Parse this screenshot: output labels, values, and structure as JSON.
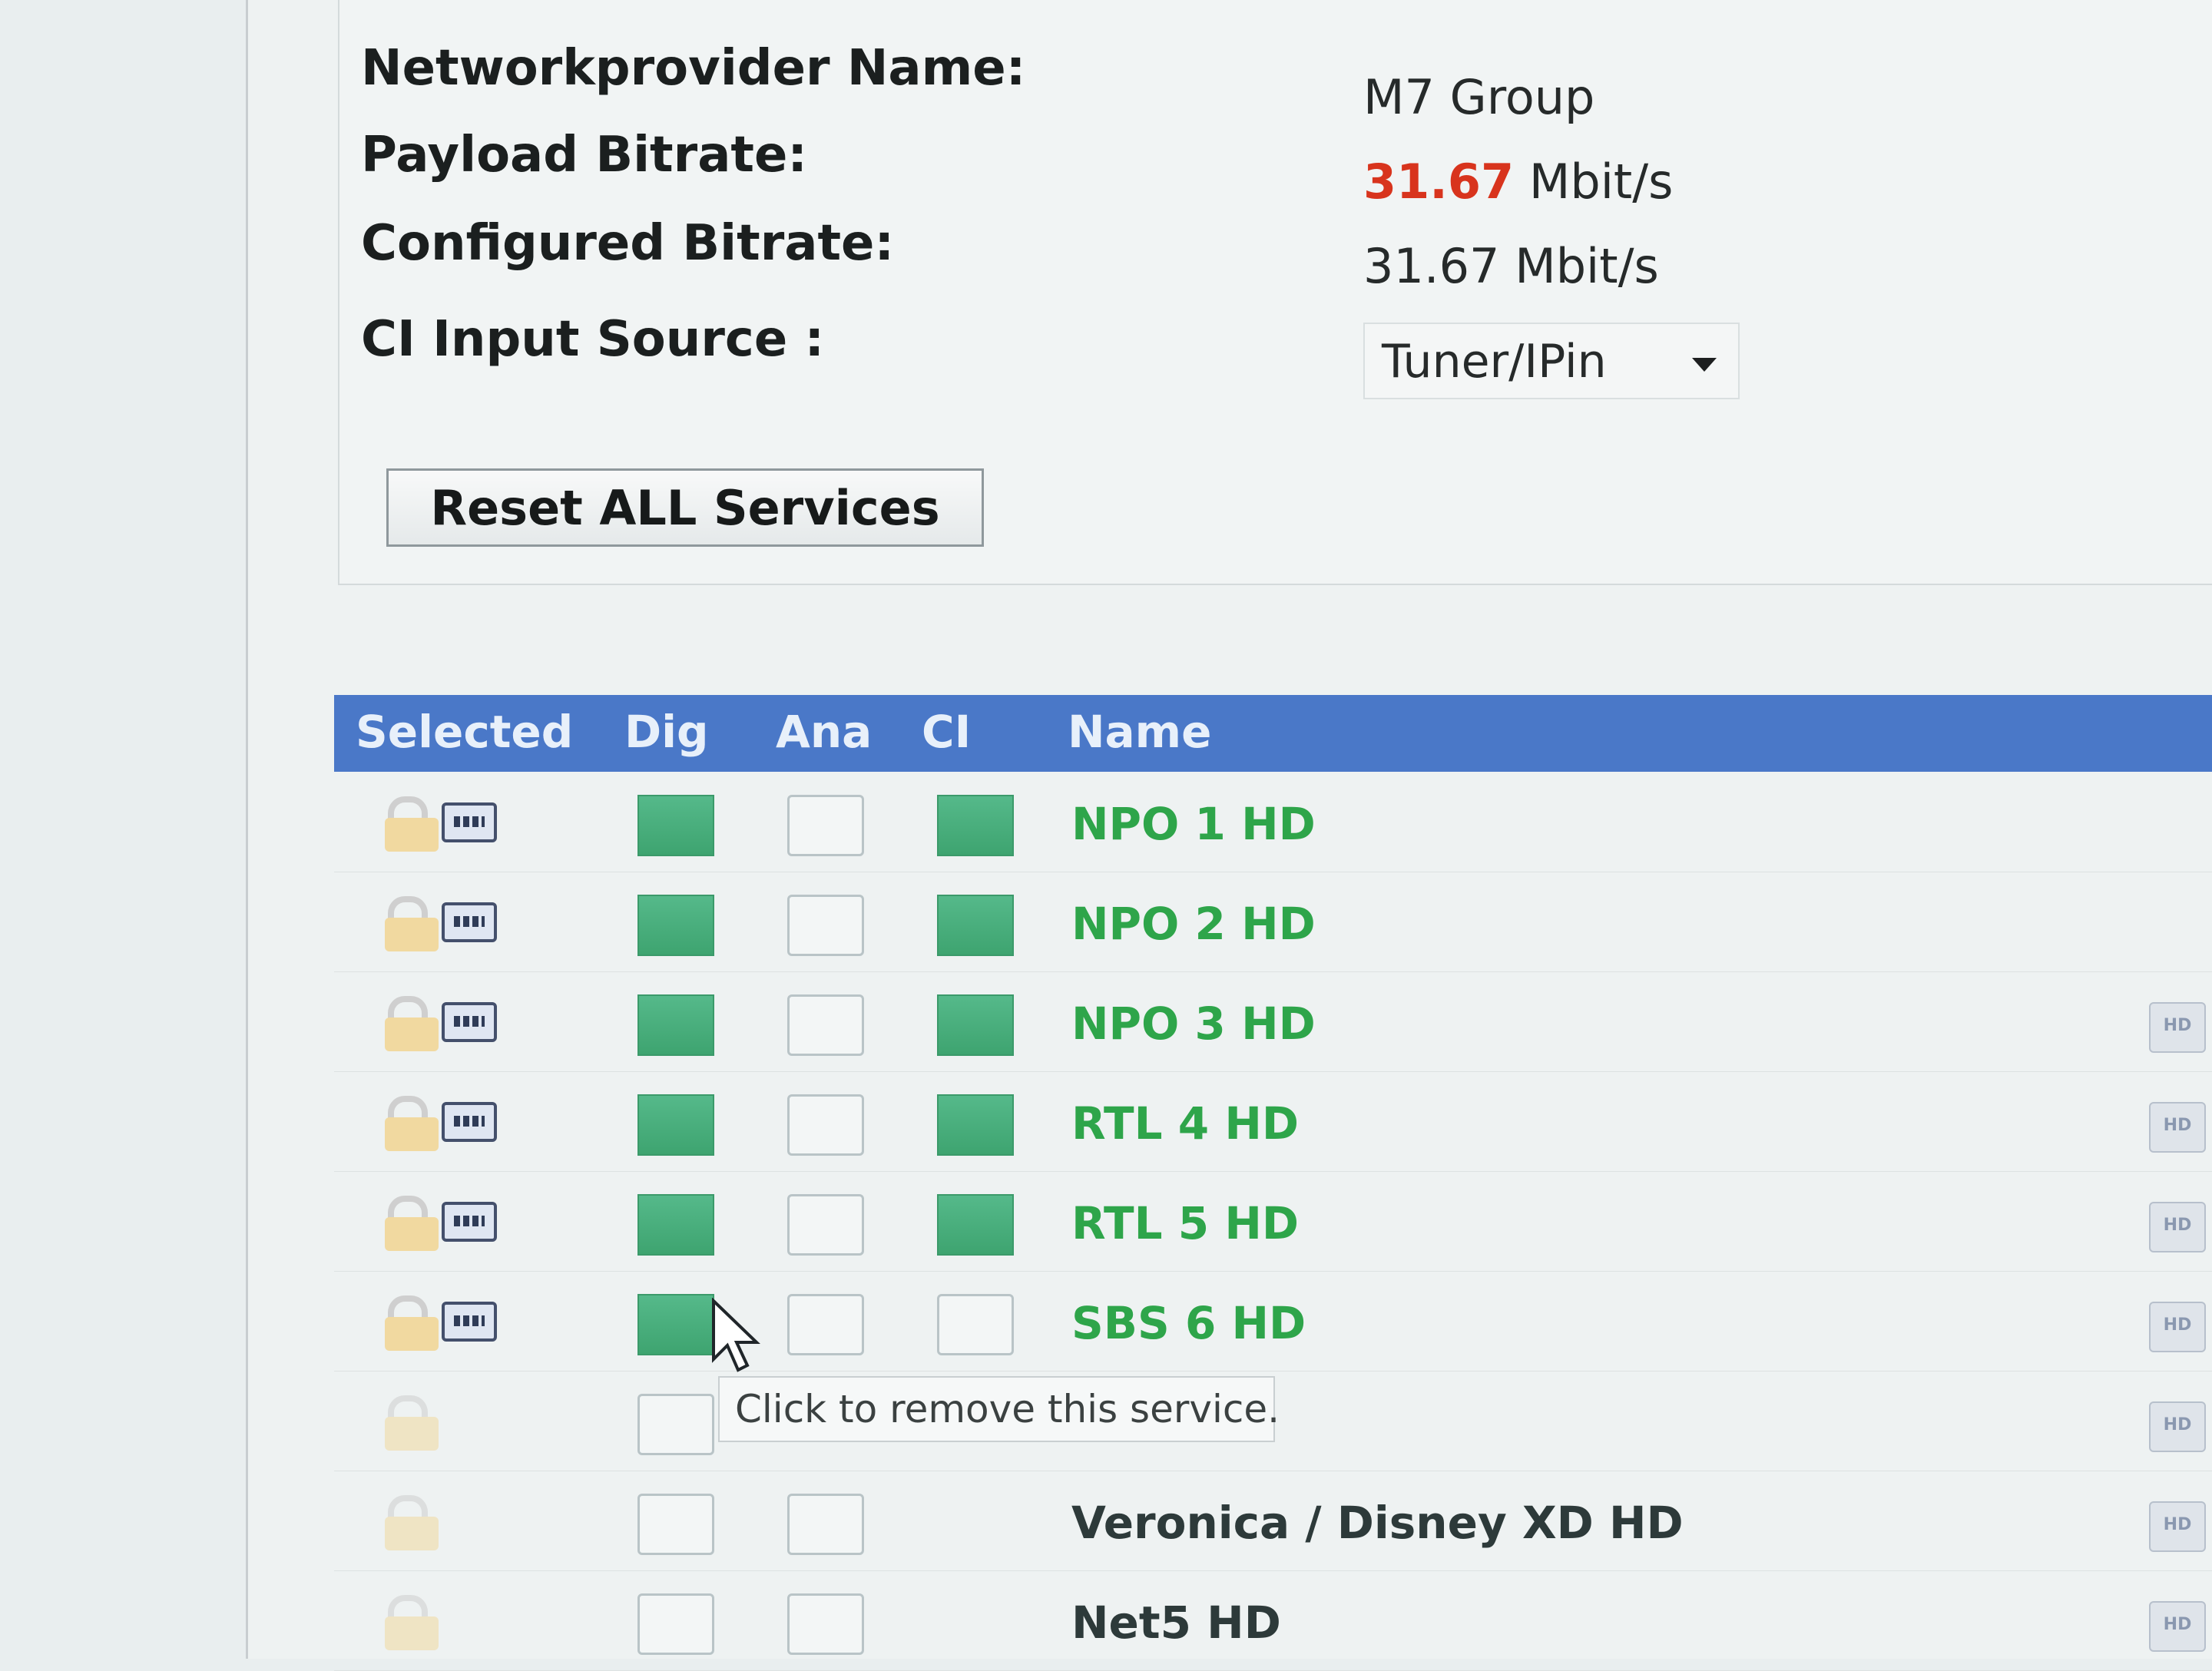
{
  "info": {
    "provider_label": "Networkprovider Name:",
    "provider_value": "M7 Group",
    "payload_label": "Payload Bitrate:",
    "payload_number": "31.67",
    "payload_unit": "Mbit/s",
    "configured_label": "Configured Bitrate:",
    "configured_value": "31.67 Mbit/s",
    "ci_label": "CI Input Source :",
    "ci_selected": "Tuner/IPin",
    "reset_label": "Reset ALL Services"
  },
  "table": {
    "headers": {
      "selected": "Selected",
      "dig": "Dig",
      "ana": "Ana",
      "ci": "CI",
      "name": "Name"
    },
    "rows": [
      {
        "name": "NPO 1 HD",
        "selected": true,
        "dig": true,
        "ana": false,
        "ci": true
      },
      {
        "name": "NPO 2 HD",
        "selected": true,
        "dig": true,
        "ana": false,
        "ci": true
      },
      {
        "name": "NPO 3 HD",
        "selected": true,
        "dig": true,
        "ana": false,
        "ci": true
      },
      {
        "name": "RTL 4 HD",
        "selected": true,
        "dig": true,
        "ana": false,
        "ci": true
      },
      {
        "name": "RTL 5 HD",
        "selected": true,
        "dig": true,
        "ana": false,
        "ci": true
      },
      {
        "name": "SBS 6 HD",
        "selected": true,
        "dig": true,
        "ana": false,
        "ci": false
      },
      {
        "name": "",
        "selected": false,
        "dig": false,
        "ana": false,
        "ci": false
      },
      {
        "name": "Veronica / Disney XD HD",
        "selected": false,
        "dig": false,
        "ana": false,
        "ci": false
      },
      {
        "name": "Net5 HD",
        "selected": false,
        "dig": false,
        "ana": false,
        "ci": false
      }
    ]
  },
  "tooltip": "Click to remove this service.",
  "colors": {
    "header_bg": "#4a78c8",
    "selected_name": "#2ea54a",
    "bitrate_red": "#d8341d"
  }
}
